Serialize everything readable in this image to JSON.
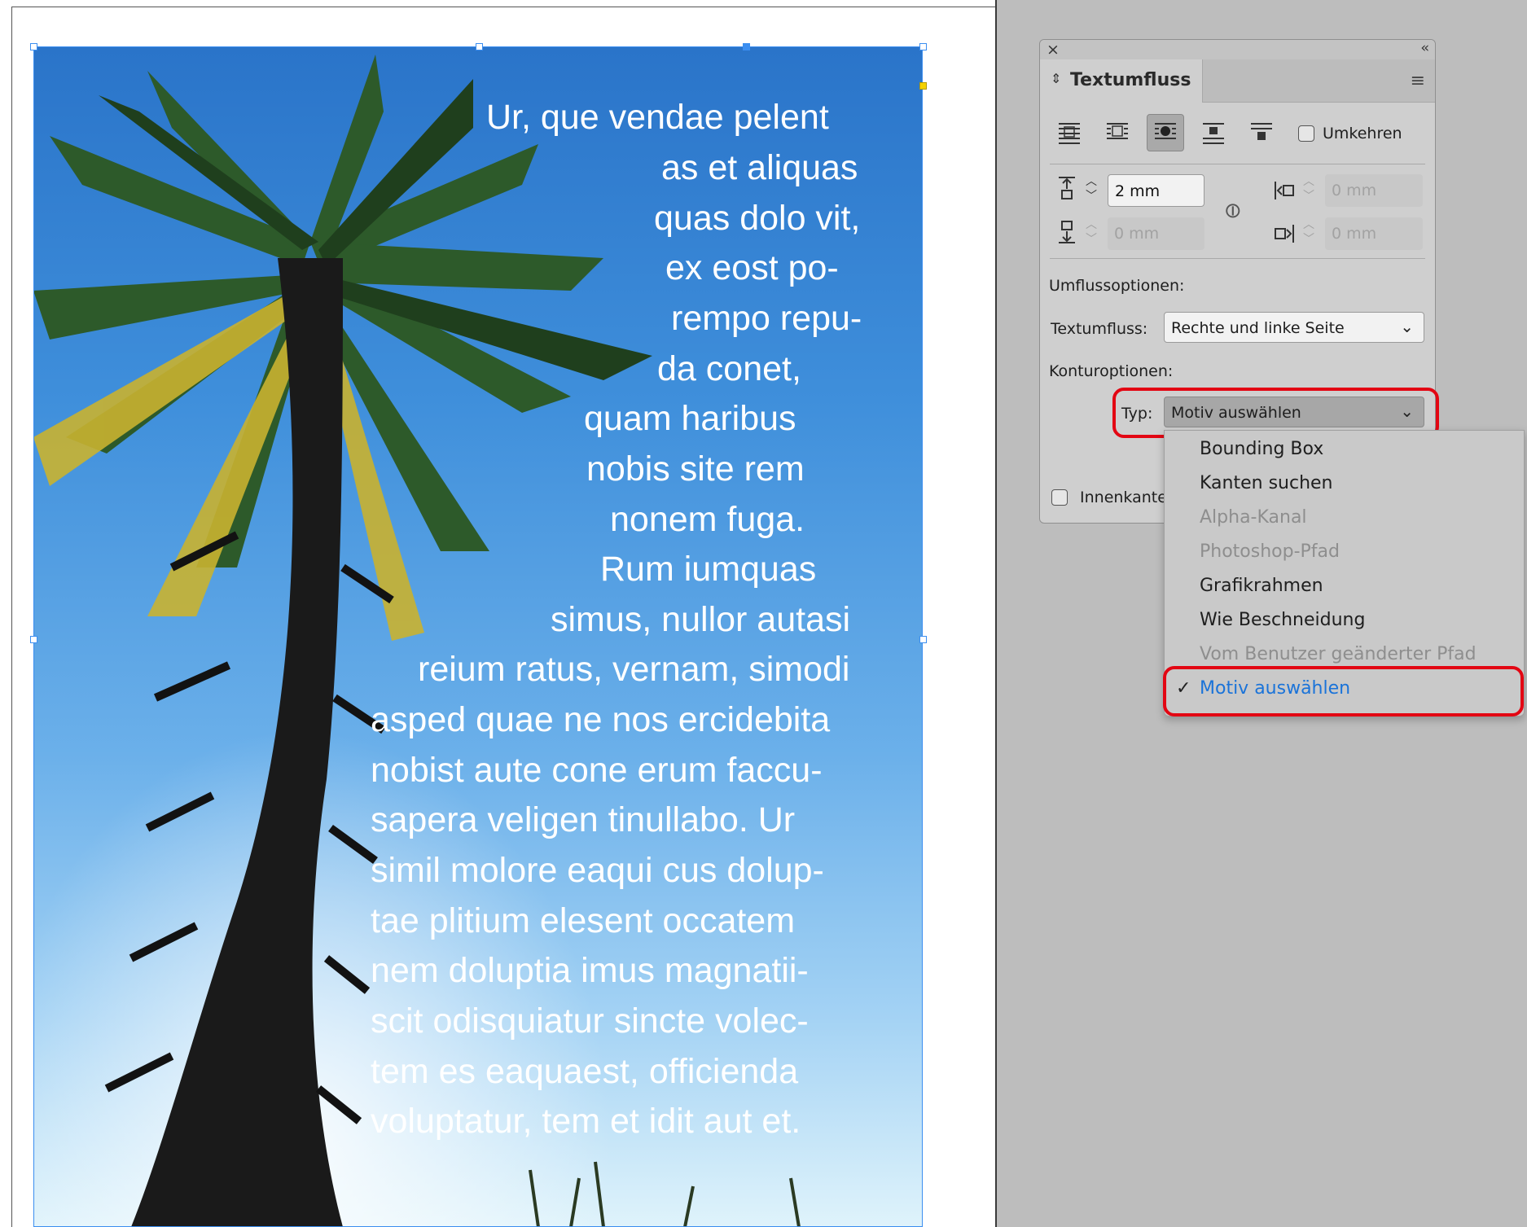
{
  "document": {
    "body_text_lines": [
      "Ur, que vendae pelent",
      "as et aliquas",
      "quas dolo vit,",
      "ex eost po-",
      "rempo repu-",
      "da conet,",
      "quam haribus",
      "nobis site rem",
      "nonem fuga.",
      "Rum iumquas",
      "simus, nullor autasi",
      "reium ratus, vernam, simodi",
      "asped quae ne nos ercidebita",
      "nobist aute cone erum faccu-",
      "sapera veligen tinullabo. Ur",
      "simil molore eaqui cus dolup-",
      "tae plitium elesent occatem",
      "nem doluptia imus magnatii-",
      "scit odisquiatur sincte volec-",
      "tem es eaquaest, officienda",
      "voluptatur, tem et idit aut et."
    ],
    "frame_color": "#3b8ef0"
  },
  "panel": {
    "tab_title": "Textumfluss",
    "invert_label": "Umkehren",
    "offsets": {
      "top": "2 mm",
      "bottom": "0 mm",
      "left": "0 mm",
      "right": "0 mm"
    },
    "wrap_options_heading": "Umflussoptionen:",
    "wrap_to_label": "Textumfluss:",
    "wrap_to_value": "Rechte und linke Seite",
    "contour_heading": "Konturoptionen:",
    "type_label": "Typ:",
    "type_value": "Motiv auswählen",
    "inner_edges_label": "Innenkante"
  },
  "dropdown": {
    "options": [
      {
        "label": "Bounding Box",
        "enabled": true
      },
      {
        "label": "Kanten suchen",
        "enabled": true
      },
      {
        "label": "Alpha-Kanal",
        "enabled": false
      },
      {
        "label": "Photoshop-Pfad",
        "enabled": false
      },
      {
        "label": "Grafikrahmen",
        "enabled": true
      },
      {
        "label": "Wie Beschneidung",
        "enabled": true
      },
      {
        "label": "Vom Benutzer geänderter Pfad",
        "enabled": false
      },
      {
        "label": "Motiv auswählen",
        "enabled": true,
        "selected": true
      }
    ],
    "selected_color": "#1a73d9"
  },
  "highlight_color": "#e30613"
}
